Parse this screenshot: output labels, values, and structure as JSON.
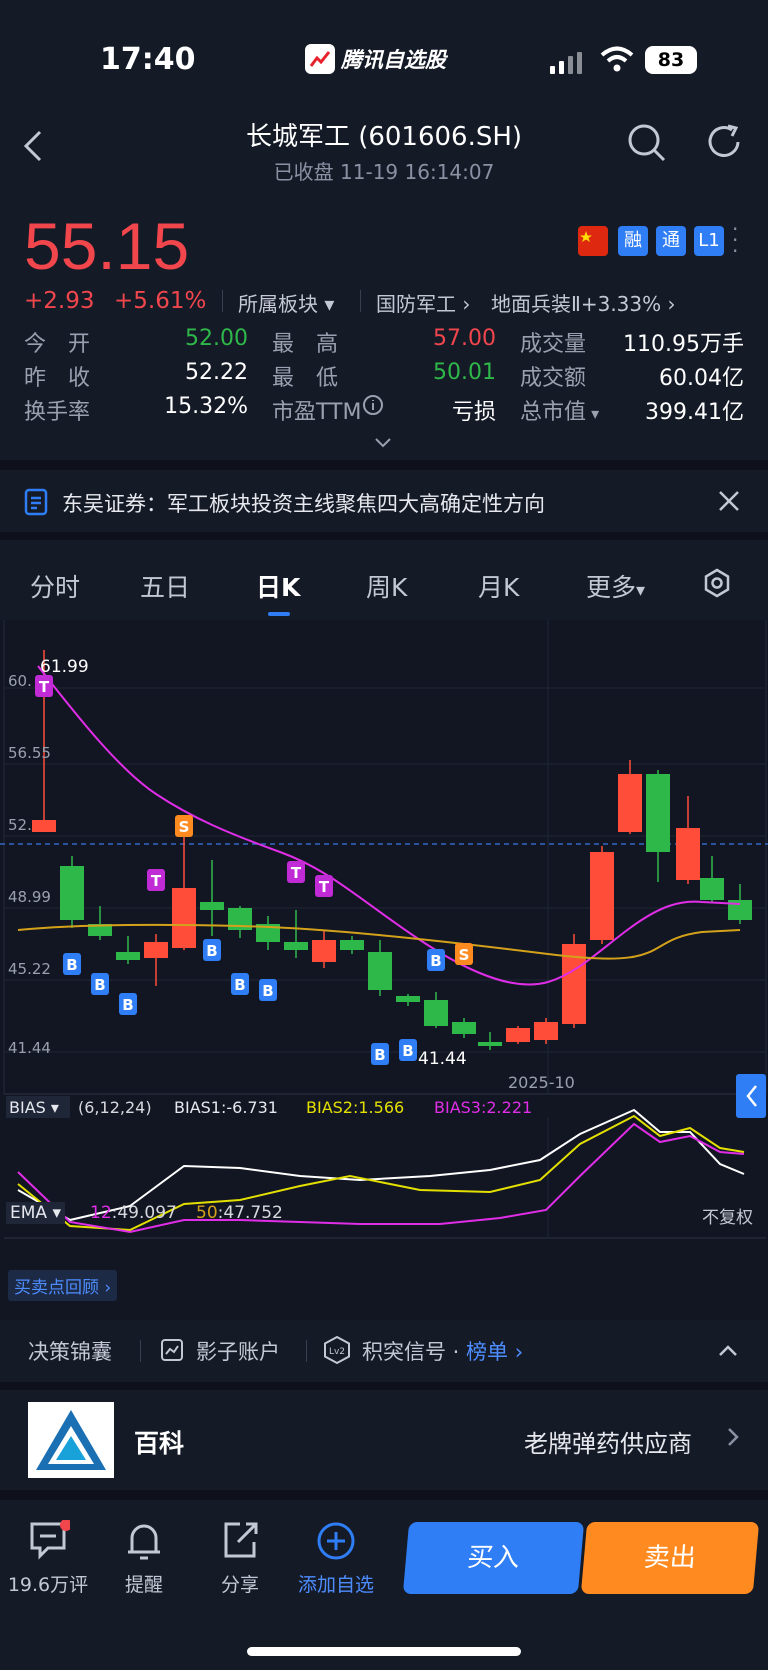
{
  "status_bar": {
    "time": "17:40",
    "app_name": "腾讯自选股",
    "battery": "83"
  },
  "header": {
    "title": "长城军工 (601606.SH)",
    "subtitle": "已收盘   11-19 16:14:07"
  },
  "quote": {
    "price": "55.15",
    "change": "+2.93",
    "change_pct": "+5.61%",
    "sector_label": "所属板块",
    "sector1": "国防军工",
    "sector2": "地面兵装Ⅱ+3.33%",
    "badges": [
      "融",
      "通",
      "L1"
    ],
    "open_label": "今　开",
    "open": "52.00",
    "high_label": "最　高",
    "high": "57.00",
    "volume_label": "成交量",
    "volume": "110.95万手",
    "prev_label": "昨　收",
    "prev": "52.22",
    "low_label": "最　低",
    "low": "50.01",
    "amount_label": "成交额",
    "amount": "60.04亿",
    "turnover_label": "换手率",
    "turnover": "15.32%",
    "pe_label": "市盈TTM",
    "pe": "亏损",
    "mcap_label": "总市值",
    "mcap": "399.41亿"
  },
  "news": {
    "text": "东吴证券：军工板块投资主线聚焦四大高确定性方向"
  },
  "tabs": [
    "分时",
    "五日",
    "日K",
    "周K",
    "月K",
    "更多"
  ],
  "chart": {
    "ema_label": "EMA",
    "ema12_label": "12",
    "ema12": ":49.097",
    "ema50_label": "50",
    "ema50": ":47.752",
    "adjust": "不复权",
    "review": "买卖点回顾",
    "y_labels": [
      "60.",
      "56.55",
      "52.",
      "48.99",
      "45.22",
      "41.44"
    ],
    "max_label": "61.99",
    "min_label": "41.44",
    "x_label": "2025-10",
    "bias_label": "BIAS",
    "bias_params": "(6,12,24)",
    "bias1": "BIAS1:-6.731",
    "bias2": "BIAS2:1.566",
    "bias3": "BIAS3:2.221",
    "colors": {
      "up": "#ff4d3a",
      "down": "#2fb84a",
      "ema12": "#e02de8",
      "ema50": "#d4a11a"
    }
  },
  "decision": {
    "item1": "决策锦囊",
    "item2": "影子账户",
    "item3": "积突信号 · ",
    "item3_link": "榜单"
  },
  "baike": {
    "label": "百科",
    "desc": "老牌弹药供应商"
  },
  "bottom": {
    "comments": "19.6万评",
    "remind": "提醒",
    "share": "分享",
    "add": "添加自选",
    "buy": "买入",
    "sell": "卖出"
  }
}
